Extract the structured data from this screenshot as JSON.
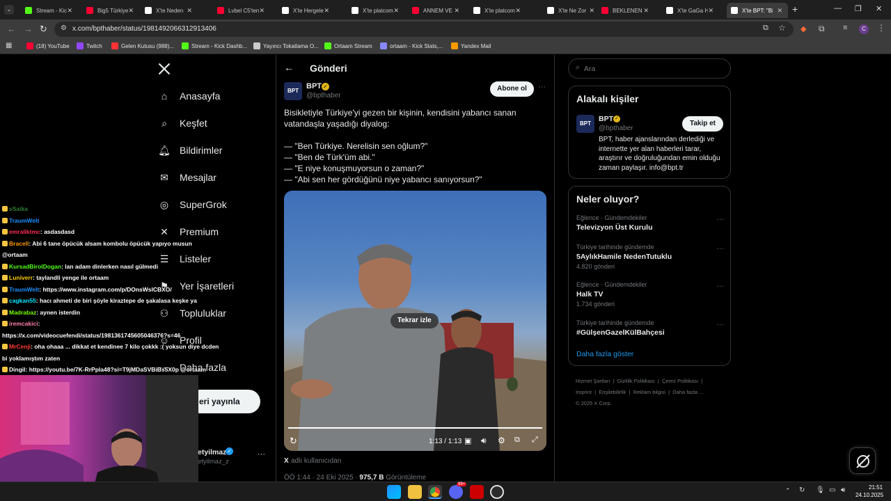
{
  "browser": {
    "tabs": [
      {
        "label": "Stream - Kick",
        "color": "#53fc18",
        "active": false
      },
      {
        "label": "Big5 Türkiye",
        "color": "#ff0033",
        "active": false
      },
      {
        "label": "X'te Neden",
        "color": "#ffffff",
        "active": false
      },
      {
        "label": "Lvbel C5'ten",
        "color": "#ff0033",
        "active": false
      },
      {
        "label": "X'te Hergele",
        "color": "#ffffff",
        "active": false
      },
      {
        "label": "X'te platcom",
        "color": "#ffffff",
        "active": false
      },
      {
        "label": "ANNEM VE",
        "color": "#ff0033",
        "active": false
      },
      {
        "label": "X'te platcom",
        "color": "#ffffff",
        "active": false
      },
      {
        "label": "X'te Ne Zor",
        "color": "#ffffff",
        "active": false
      },
      {
        "label": "BEKLENEN D",
        "color": "#ff0033",
        "active": false
      },
      {
        "label": "X'te GaGa H",
        "color": "#ffffff",
        "active": false
      },
      {
        "label": "X'te BPT: \"Bi",
        "color": "#ffffff",
        "active": true
      }
    ],
    "new_tab": "+",
    "url": "x.com/bpthaber/status/1981492066312913406",
    "profile_letter": "C",
    "bookmarks": [
      {
        "label": "(18) YouTube",
        "color": "#ff0033"
      },
      {
        "label": "Twitch",
        "color": "#9146ff"
      },
      {
        "label": "Gelen Kutusu (988)...",
        "color": "#ff3333"
      },
      {
        "label": "Stream - Kick Dashb...",
        "color": "#53fc18"
      },
      {
        "label": "Yayıncı Tokatlama O...",
        "color": "#cccccc"
      },
      {
        "label": "Ortaam Stream",
        "color": "#53fc18"
      },
      {
        "label": "ortaam - Kick Stats,...",
        "color": "#8888ff"
      },
      {
        "label": "Yandex Mail",
        "color": "#ff9900"
      }
    ]
  },
  "x": {
    "nav": [
      {
        "label": "Anasayfa",
        "icon": "home-icon"
      },
      {
        "label": "Keşfet",
        "icon": "search-icon"
      },
      {
        "label": "Bildirimler",
        "icon": "bell-icon"
      },
      {
        "label": "Mesajlar",
        "icon": "mail-icon"
      },
      {
        "label": "SuperGrok",
        "icon": "grok-icon"
      },
      {
        "label": "Premium",
        "icon": "x-logo-icon"
      },
      {
        "label": "Listeler",
        "icon": "list-icon"
      },
      {
        "label": "Yer İşaretleri",
        "icon": "bookmark-icon"
      },
      {
        "label": "Topluluklar",
        "icon": "communities-icon"
      },
      {
        "label": "Profil",
        "icon": "profile-icon"
      },
      {
        "label": "Daha fazla",
        "icon": "more-icon"
      }
    ],
    "post_button": "eri yayınla",
    "account": {
      "name": "etyilmaz",
      "handle": "etyilmaz_z"
    },
    "header_title": "Gönderi",
    "post": {
      "author_name": "BPT",
      "author_handle": "@bpthaber",
      "subscribe": "Abone ol",
      "avatar_text": "BPT",
      "lines": [
        "Bisikletiyle Türkiye'yi gezen bir kişinin, kendisini yabancı sanan",
        "vatandaşla yaşadığı diyalog:",
        "",
        "— \"Ben Türkiye. Nerelisin sen oğlum?\"",
        "— \"Ben de Türk'üm abi.\"",
        "— \"E niye konuşmuyorsun o zaman?\"",
        "— \"Abi sen her gördüğünü niye yabancı sanıyorsun?\""
      ],
      "replay": "Tekrar izle",
      "time": "1:13 / 1:13",
      "progress": 1.0,
      "source_prefix": "X",
      "source": "adlı kullanıcıdan",
      "meta": "ÖÖ 1:44 · 24 Eki 2025 · ",
      "views": "975,7 B",
      "views_label": "Görüntüleme"
    },
    "search_placeholder": "Ara",
    "related": {
      "title": "Alakalı kişiler",
      "name": "BPT",
      "handle": "@bpthaber",
      "follow": "Takip et",
      "bio": [
        "BPT, haber ajanslarından derlediği ve",
        "internette yer alan haberleri tarar,",
        "araştırır ve doğruluğundan emin olduğu",
        "zaman paylaşır. info@bpt.tr"
      ]
    },
    "trends": {
      "title": "Neler oluyor?",
      "items": [
        {
          "context": "Eğlence · Gündemdekiler",
          "title": "Televizyon Üst Kurulu",
          "count": ""
        },
        {
          "context": "Türkiye tarihinde gündemde",
          "title": "5AylıkHamile NedenTutuklu",
          "count": "4.820 gönderi"
        },
        {
          "context": "Eğlence · Gündemdekiler",
          "title": "Halk TV",
          "count": "1.734 gönderi"
        },
        {
          "context": "Türkiye tarihinde gündemde",
          "title": "#GülşenGazelKülBahçesi",
          "count": ""
        }
      ],
      "show_more": "Daha fazla göster"
    },
    "footer": [
      "Hizmet Şartları",
      "Gizlilik Politikası",
      "Çerez Politikası",
      "Imprint",
      "Erişilebilirlik",
      "Reklam bilgisi",
      "Daha fazla ...",
      "© 2025 X Corp."
    ]
  },
  "chat": [
    {
      "user": "sSaika",
      "color": "#2e7d32",
      "text": ""
    },
    {
      "user": "TraumWelt",
      "color": "#1e90ff",
      "text": ""
    },
    {
      "user": "emraliktmc",
      "color": "#ff2d55",
      "text": ": asdasdasd"
    },
    {
      "user": "Bracell",
      "color": "#ff9900",
      "text": ": Abi 6 tane öpücük alsam kombolu öpücük yapıyo musun"
    },
    {
      "user": "",
      "color": "#ffffff",
      "text": "@ortaam"
    },
    {
      "user": "KursadBirolDogan",
      "color": "#53fc18",
      "text": ": lan adam dinlerken nasıl gülmedi"
    },
    {
      "user": "Luniverr",
      "color": "#ffcc00",
      "text": ": taylandli yenge ile ortaam"
    },
    {
      "user": "TraumWelt",
      "color": "#1e90ff",
      "text": ": https://www.instagram.com/p/DOnsWslCBXO/"
    },
    {
      "user": "cagkan55",
      "color": "#00e5ff",
      "text": ": hacı ahmeti de biri şöyle kiraztepe de şakalasa keşke ya"
    },
    {
      "user": "Madrabaz",
      "color": "#76ff03",
      "text": ": aynen isterdin"
    },
    {
      "user": "iremcakici",
      "color": "#ff80ab",
      "text": ":"
    },
    {
      "user": "",
      "color": "#ffffff",
      "text": "https://x.com/videocuefendi/status/1981361745605046376?s=46"
    },
    {
      "user": "MrCenji",
      "color": "#ff3b30",
      "text": ": oha ohaaa ... dikkat et kendinee 7 kilo çokkk :( yoksun diye dcden"
    },
    {
      "user": "",
      "color": "#ffffff",
      "text": "bi yoklamıştım zaten"
    },
    {
      "user": "Dingil",
      "color": "#ffffff",
      "text": ": https://youtu.be/7K-RrPpla48?si=T9jMDaSVBiBs5X0p @ortaam"
    }
  ],
  "taskbar": {
    "time": "21:51",
    "date": "24.10.2025",
    "badge": "99+"
  }
}
